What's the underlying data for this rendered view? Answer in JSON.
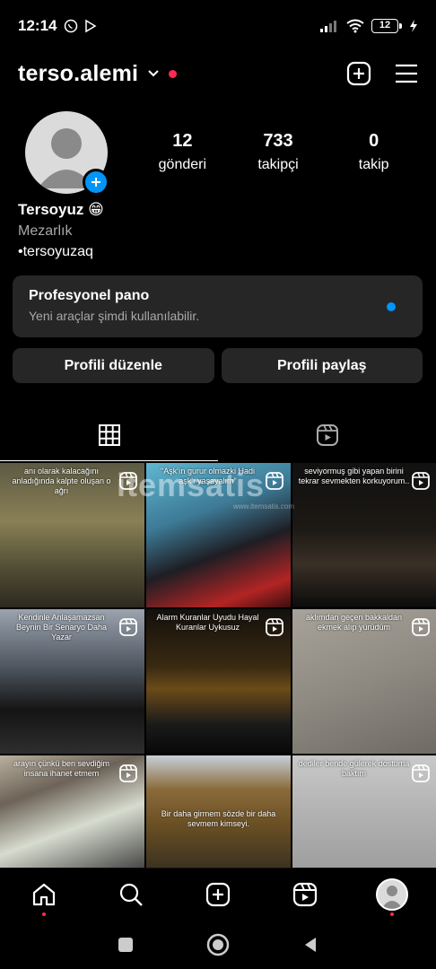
{
  "status_bar": {
    "time": "12:14",
    "battery": "12"
  },
  "header": {
    "username": "terso.alemi"
  },
  "profile": {
    "stats": [
      {
        "value": "12",
        "label": "gönderi"
      },
      {
        "value": "733",
        "label": "takipçi"
      },
      {
        "value": "0",
        "label": "takip"
      }
    ],
    "name": "Tersoyuz 😁",
    "category": "Mezarlık",
    "handle": "•tersoyuzaq"
  },
  "pro_panel": {
    "title": "Profesyonel pano",
    "subtitle": "Yeni araçlar şimdi kullanılabilir."
  },
  "buttons": {
    "edit": "Profili düzenle",
    "share": "Profili paylaş"
  },
  "grid": {
    "posts": [
      {
        "caption": "anı olarak kalacağını anladığında kalpte oluşan o ağrı"
      },
      {
        "caption": "\"Aşk'ın gurur olmazki Hadi aşk'ı yaşayalım\""
      },
      {
        "caption": "seviyormuş gibi yapan birini tekrar sevmekten korkuyorum.."
      },
      {
        "caption": "Kendinle Anlaşamazsan Beynin Bir Senaryo Daha Yazar"
      },
      {
        "caption": "Alarm Kuranlar Uyudu Hayal Kuranlar Uykusuz"
      },
      {
        "caption": "aklımdan geçen bakkaldan ekmek alıp yürüdüm"
      },
      {
        "caption": "arayın çünkü ben sevdiğim insana ihanet etmem"
      },
      {
        "caption": "Bir daha girmem sözde bir daha sevmem kimseyi."
      },
      {
        "caption": "dediler bende gülerek dostuma baktım"
      }
    ],
    "watermark": "itemsatis",
    "watermark_sub": "www.itemsatis.com"
  },
  "colors": {
    "accent": "#0095f6",
    "notification": "#ff2a4f",
    "panel": "#262626"
  }
}
